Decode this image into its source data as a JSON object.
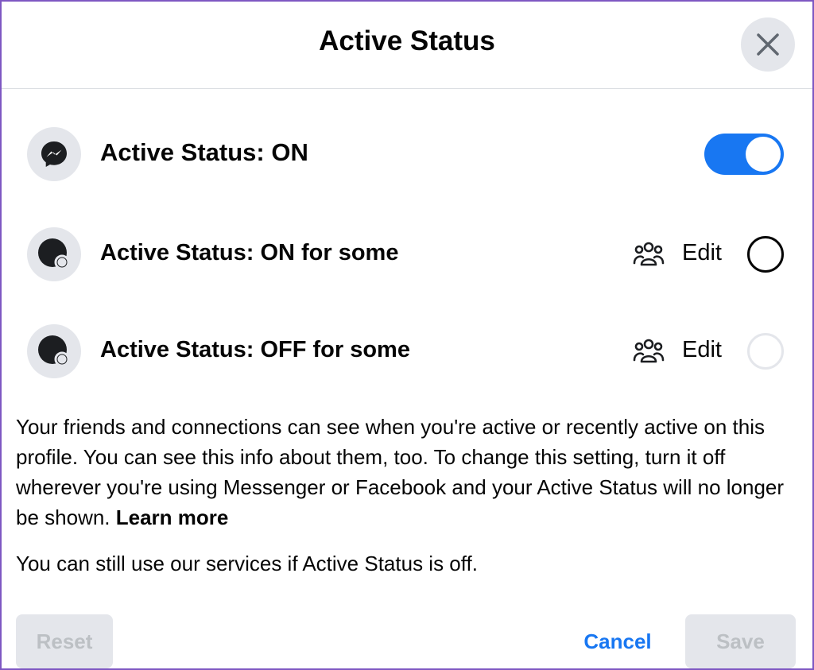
{
  "dialog": {
    "title": "Active Status",
    "close_icon": "close-icon"
  },
  "options": [
    {
      "label": "Active Status: ON",
      "icon": "messenger-icon",
      "control": "toggle",
      "toggle_on": true
    },
    {
      "label": "Active Status: ON for some",
      "icon": "status-dot-icon",
      "edit_label": "Edit",
      "selected": true
    },
    {
      "label": "Active Status: OFF for some",
      "icon": "status-dot-icon",
      "edit_label": "Edit",
      "selected": false
    }
  ],
  "description": {
    "text": "Your friends and connections can see when you're active or recently active on this profile. You can see this info about them, too. To change this setting, turn it off wherever you're using Messenger or Facebook and your Active Status will no longer be shown. ",
    "link": "Learn more"
  },
  "note": "You can still use our services if Active Status is off.",
  "footer": {
    "reset_label": "Reset",
    "cancel_label": "Cancel",
    "save_label": "Save"
  },
  "colors": {
    "accent": "#1877f2",
    "surface": "#e4e6eb",
    "disabled_text": "#bcc0c4",
    "frame": "#7e57c2"
  }
}
